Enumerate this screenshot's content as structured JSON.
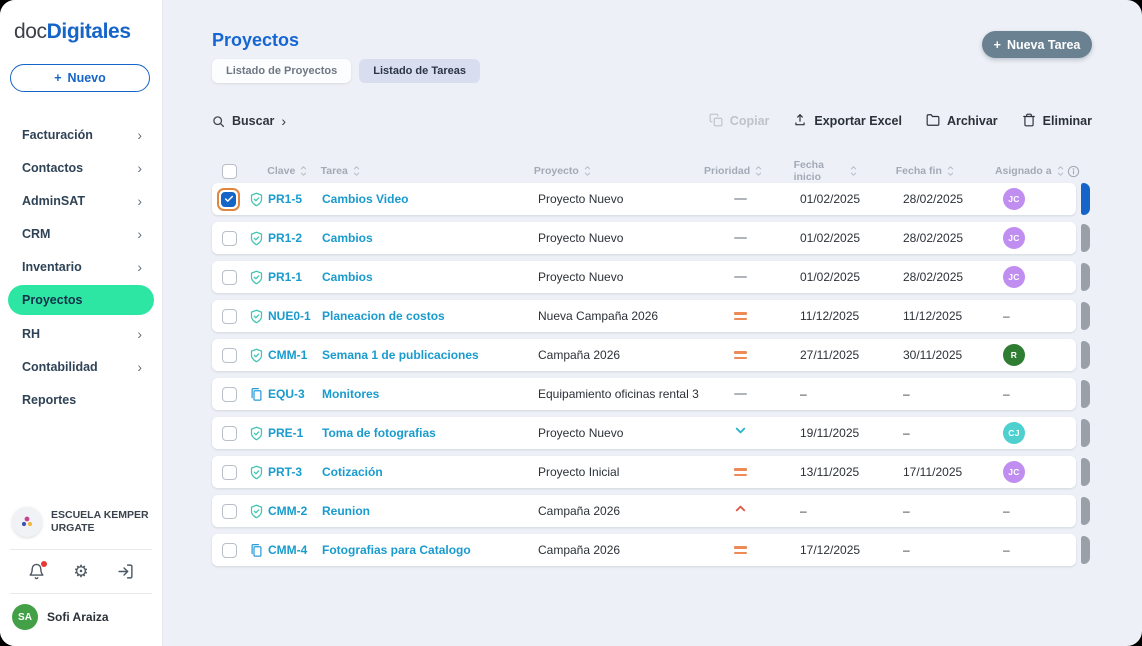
{
  "icons": {
    "plus": "+",
    "chevron_right": "›",
    "gear": "⚙"
  },
  "colors": {
    "accent_blue": "#1565c8",
    "active_green": "#2ee6a4",
    "link_teal": "#199bce",
    "priority_orange": "#ee8a56",
    "priority_red": "#dd5a4f",
    "priority_teal": "#25b5c9",
    "selected_ring_orange": "#e0863f",
    "new_task_slate": "#6a8191"
  },
  "app": {
    "logo_prefix": "doc",
    "logo_suffix": "Digitales"
  },
  "sidebar": {
    "new_button_label": "Nuevo",
    "items": [
      {
        "label": "Facturación",
        "has_submenu": true,
        "active": false
      },
      {
        "label": "Contactos",
        "has_submenu": true,
        "active": false
      },
      {
        "label": "AdminSAT",
        "has_submenu": true,
        "active": false
      },
      {
        "label": "CRM",
        "has_submenu": true,
        "active": false
      },
      {
        "label": "Inventario",
        "has_submenu": true,
        "active": false
      },
      {
        "label": "Proyectos",
        "has_submenu": false,
        "active": true
      },
      {
        "label": "RH",
        "has_submenu": true,
        "active": false
      },
      {
        "label": "Contabilidad",
        "has_submenu": true,
        "active": false
      },
      {
        "label": "Reportes",
        "has_submenu": false,
        "active": false
      }
    ],
    "org_name": "ESCUELA KEMPER URGATE",
    "user": {
      "initials": "SA",
      "name": "Sofi Araiza"
    }
  },
  "header": {
    "title": "Proyectos",
    "tabs": [
      {
        "label": "Listado de Proyectos",
        "active": false
      },
      {
        "label": "Listado de Tareas",
        "active": true
      }
    ],
    "new_task_label": "Nueva Tarea"
  },
  "toolbar": {
    "search_label": "Buscar",
    "actions": [
      {
        "id": "copy",
        "label": "Copiar",
        "icon": "copy",
        "disabled": true
      },
      {
        "id": "export-excel",
        "label": "Exportar Excel",
        "icon": "upload",
        "disabled": false
      },
      {
        "id": "archive",
        "label": "Archivar",
        "icon": "folder",
        "disabled": false
      },
      {
        "id": "delete",
        "label": "Eliminar",
        "icon": "trash",
        "disabled": false
      }
    ]
  },
  "table": {
    "empty_value": "–",
    "columns": [
      {
        "id": "clave",
        "label": "Clave"
      },
      {
        "id": "tarea",
        "label": "Tarea"
      },
      {
        "id": "proyecto",
        "label": "Proyecto"
      },
      {
        "id": "prioridad",
        "label": "Prioridad"
      },
      {
        "id": "fecha_inicio",
        "label": "Fecha inicio"
      },
      {
        "id": "fecha_fin",
        "label": "Fecha fin"
      },
      {
        "id": "asignado",
        "label": "Asignado a"
      }
    ],
    "rows": [
      {
        "selected": true,
        "type_icon": "shield-check",
        "clave": "PR1-5",
        "tarea": "Cambios Video",
        "proyecto": "Proyecto Nuevo",
        "prioridad": "none",
        "fecha_inicio": "01/02/2025",
        "fecha_fin": "28/02/2025",
        "asignado": {
          "initials": "JC",
          "color": "#c08df0"
        }
      },
      {
        "selected": false,
        "type_icon": "shield-check",
        "clave": "PR1-2",
        "tarea": "Cambios",
        "proyecto": "Proyecto Nuevo",
        "prioridad": "none",
        "fecha_inicio": "01/02/2025",
        "fecha_fin": "28/02/2025",
        "asignado": {
          "initials": "JC",
          "color": "#c08df0"
        }
      },
      {
        "selected": false,
        "type_icon": "shield-check",
        "clave": "PR1-1",
        "tarea": "Cambios",
        "proyecto": "Proyecto Nuevo",
        "prioridad": "none",
        "fecha_inicio": "01/02/2025",
        "fecha_fin": "28/02/2025",
        "asignado": {
          "initials": "JC",
          "color": "#c08df0"
        }
      },
      {
        "selected": false,
        "type_icon": "shield-check",
        "clave": "NUE0-1",
        "tarea": "Planeacion de costos",
        "proyecto": "Nueva Campaña 2026",
        "prioridad": "medium",
        "fecha_inicio": "11/12/2025",
        "fecha_fin": "11/12/2025",
        "asignado": null
      },
      {
        "selected": false,
        "type_icon": "shield-check",
        "clave": "CMM-1",
        "tarea": "Semana 1 de publicaciones",
        "proyecto": "Campaña 2026",
        "prioridad": "medium",
        "fecha_inicio": "27/11/2025",
        "fecha_fin": "30/11/2025",
        "asignado": {
          "initials": "R",
          "color": "#2e7d32"
        }
      },
      {
        "selected": false,
        "type_icon": "document-copy",
        "clave": "EQU-3",
        "tarea": "Monitores",
        "proyecto": "Equipamiento oficinas rental 3",
        "prioridad": "none",
        "fecha_inicio": "–",
        "fecha_fin": "–",
        "asignado": null
      },
      {
        "selected": false,
        "type_icon": "shield-check",
        "clave": "PRE-1",
        "tarea": "Toma de fotografias",
        "proyecto": "Proyecto Nuevo",
        "prioridad": "low",
        "fecha_inicio": "19/11/2025",
        "fecha_fin": "–",
        "asignado": {
          "initials": "CJ",
          "color": "#4dd0ce"
        }
      },
      {
        "selected": false,
        "type_icon": "shield-check",
        "clave": "PRT-3",
        "tarea": "Cotización",
        "proyecto": "Proyecto Inicial",
        "prioridad": "medium",
        "fecha_inicio": "13/11/2025",
        "fecha_fin": "17/11/2025",
        "asignado": {
          "initials": "JC",
          "color": "#c08df0"
        }
      },
      {
        "selected": false,
        "type_icon": "shield-check",
        "clave": "CMM-2",
        "tarea": "Reunion",
        "proyecto": "Campaña 2026",
        "prioridad": "high",
        "fecha_inicio": "–",
        "fecha_fin": "–",
        "asignado": null
      },
      {
        "selected": false,
        "type_icon": "document-copy",
        "clave": "CMM-4",
        "tarea": "Fotografias para Catalogo",
        "proyecto": "Campaña 2026",
        "prioridad": "medium",
        "fecha_inicio": "17/12/2025",
        "fecha_fin": "–",
        "asignado": null
      }
    ]
  }
}
